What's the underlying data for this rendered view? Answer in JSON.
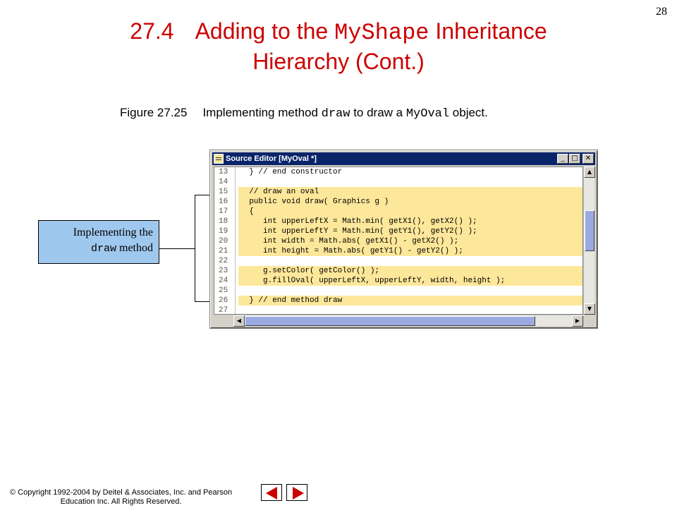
{
  "page_number": "28",
  "title": {
    "number": "27.4",
    "line1_prefix": "Adding to the ",
    "line1_code": "MyShape",
    "line1_suffix": " Inheritance",
    "line2": "Hierarchy (Cont.)"
  },
  "caption": {
    "label": "Figure 27.25",
    "text_prefix": "Implementing method ",
    "code1": "draw",
    "text_middle": " to draw a ",
    "code2": "MyOval",
    "text_suffix": " object."
  },
  "window": {
    "title": "Source Editor [MyOval *]",
    "buttons": {
      "minimize": "_",
      "maximize": "□",
      "close": "✕"
    },
    "scroll_up": "▲",
    "scroll_down": "▼",
    "scroll_left": "◀",
    "scroll_right": "▶",
    "lines": [
      {
        "num": "13",
        "code": "  } // end constructor",
        "hl": false
      },
      {
        "num": "14",
        "code": "",
        "hl": false
      },
      {
        "num": "15",
        "code": "  // draw an oval",
        "hl": true
      },
      {
        "num": "16",
        "code": "  public void draw( Graphics g )",
        "hl": true
      },
      {
        "num": "17",
        "code": "  {",
        "hl": true
      },
      {
        "num": "18",
        "code": "     int upperLeftX = Math.min( getX1(), getX2() );",
        "hl": true
      },
      {
        "num": "19",
        "code": "     int upperLeftY = Math.min( getY1(), getY2() );",
        "hl": true
      },
      {
        "num": "20",
        "code": "     int width = Math.abs( getX1() - getX2() );",
        "hl": true
      },
      {
        "num": "21",
        "code": "     int height = Math.abs( getY1() - getY2() );",
        "hl": true
      },
      {
        "num": "22",
        "code": "",
        "hl": true
      },
      {
        "num": "23",
        "code": "     g.setColor( getColor() );",
        "hl": true
      },
      {
        "num": "24",
        "code": "     g.fillOval( upperLeftX, upperLeftY, width, height );",
        "hl": true
      },
      {
        "num": "25",
        "code": "",
        "hl": true
      },
      {
        "num": "26",
        "code": "  } // end method draw",
        "hl": true
      },
      {
        "num": "27",
        "code": "",
        "hl": false
      }
    ]
  },
  "callout": {
    "line1": "Implementing the",
    "code": "draw",
    "line2_suffix": " method"
  },
  "footer": {
    "line1": "© Copyright 1992-2004 by Deitel & Associates, Inc. and Pearson",
    "line2": "Education Inc. All Rights Reserved."
  },
  "nav": {
    "prev_icon": "left-arrow-icon",
    "next_icon": "right-arrow-icon",
    "arrow_color": "#cc0000"
  },
  "colors": {
    "title": "#cc0000",
    "highlight": "#fde79a",
    "callout_bg": "#9fc8ee",
    "titlebar": "#0a246a"
  }
}
